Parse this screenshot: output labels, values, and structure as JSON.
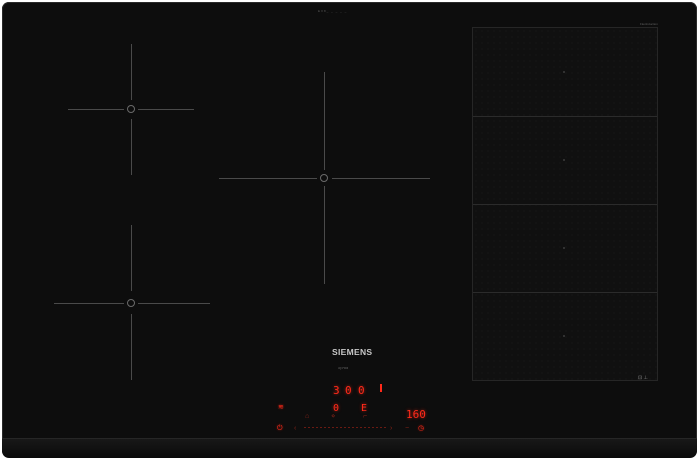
{
  "hob": {
    "top_label": "EX8_ _ _ _ _",
    "brand": "SIEMENS",
    "model": "iQ700"
  },
  "display": {
    "zone_left": "3",
    "zone_left_mid": "0",
    "zone_left_right": "0",
    "lower_left": "0",
    "lower_right": "E",
    "timer": "160"
  },
  "flex": {
    "tag_top": "FlexInduction",
    "tag_bottom": "⊡ ⊥"
  },
  "icons": {
    "power": "power-icon",
    "wifi": "wifi-icon",
    "lock": "lock-icon",
    "timer": "timer-icon",
    "flame": "flame-icon"
  },
  "accent": "#ff2a1a"
}
